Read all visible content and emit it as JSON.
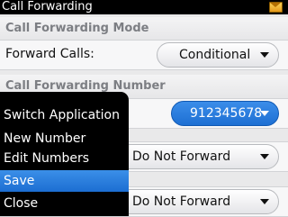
{
  "window": {
    "title": "Call Forwarding"
  },
  "status": {
    "icon": "envelope-icon"
  },
  "mode_section": {
    "header": "Call Forwarding Mode",
    "forward_calls_label": "Forward Calls:",
    "forward_calls_value": "Conditional"
  },
  "number_section": {
    "header": "Call Forwarding Number",
    "number_value": "912345678",
    "forward_option_1": "Do Not Forward",
    "forward_option_2": "Do Not Forward"
  },
  "menu": {
    "items": [
      {
        "label": "Switch Application"
      },
      {
        "label": "New Number"
      },
      {
        "label": "Edit Numbers"
      },
      {
        "label": "Save"
      },
      {
        "label": "Close"
      }
    ],
    "highlighted_index": 3
  },
  "colors": {
    "accent": "#2a7fe0",
    "menu_background": "#000000",
    "section_header_text": "#7c7e83"
  }
}
